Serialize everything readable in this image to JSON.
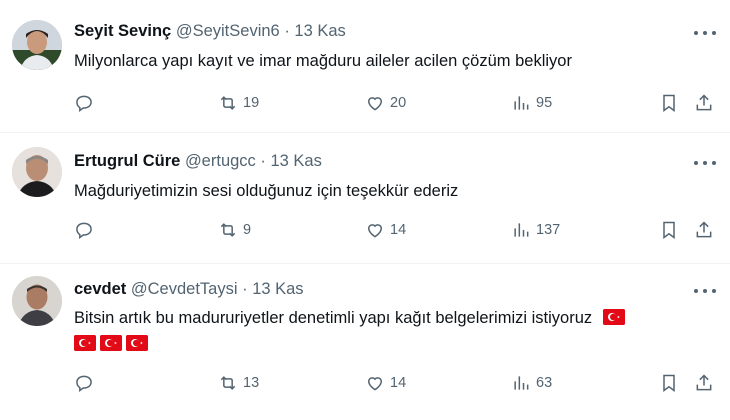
{
  "tweets": [
    {
      "name": "Seyit Sevinç",
      "handle": "@SeyitSevin6",
      "separator": "·",
      "date": "13 Kas",
      "text": "Milyonlarca yapı kayıt ve imar mağduru aileler acilen çözüm bekliyor",
      "retweets": "19",
      "likes": "20",
      "views": "95"
    },
    {
      "name": "Ertugrul Cüre",
      "handle": "@ertugcc",
      "separator": "·",
      "date": "13 Kas",
      "text": "Mağduriyetimizin sesi  olduğunuz için teşekkür ederiz",
      "retweets": "9",
      "likes": "14",
      "views": "137"
    },
    {
      "name": "cevdet",
      "handle": "@CevdetTaysi",
      "separator": "·",
      "date": "13 Kas",
      "text": "Bitsin artık bu madururiyetler denetimli yapı kağıt belgelerimizi istiyoruz",
      "flag_emoji": "turkey-flag",
      "retweets": "13",
      "likes": "14",
      "views": "63"
    }
  ],
  "colors": {
    "text_primary": "#0f1419",
    "text_secondary": "#536471",
    "divider": "#eff3f4",
    "flag_red": "#e30a17"
  }
}
